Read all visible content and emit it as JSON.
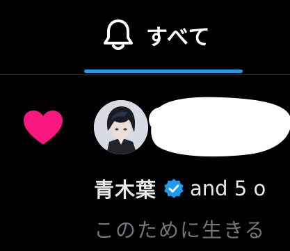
{
  "tabs": {
    "active_label": "すべて",
    "active_icon": "bell-icon"
  },
  "notification": {
    "type_icon": "heart-icon",
    "user_name": "青木葉",
    "verified": true,
    "others_text": "and 5 o",
    "preview_text": "このために生きる"
  },
  "colors": {
    "background": "#000000",
    "accent_blue": "#1d9bf0",
    "heart": "#f91880",
    "text_primary": "#e7e9ea",
    "text_secondary": "#71767b"
  }
}
